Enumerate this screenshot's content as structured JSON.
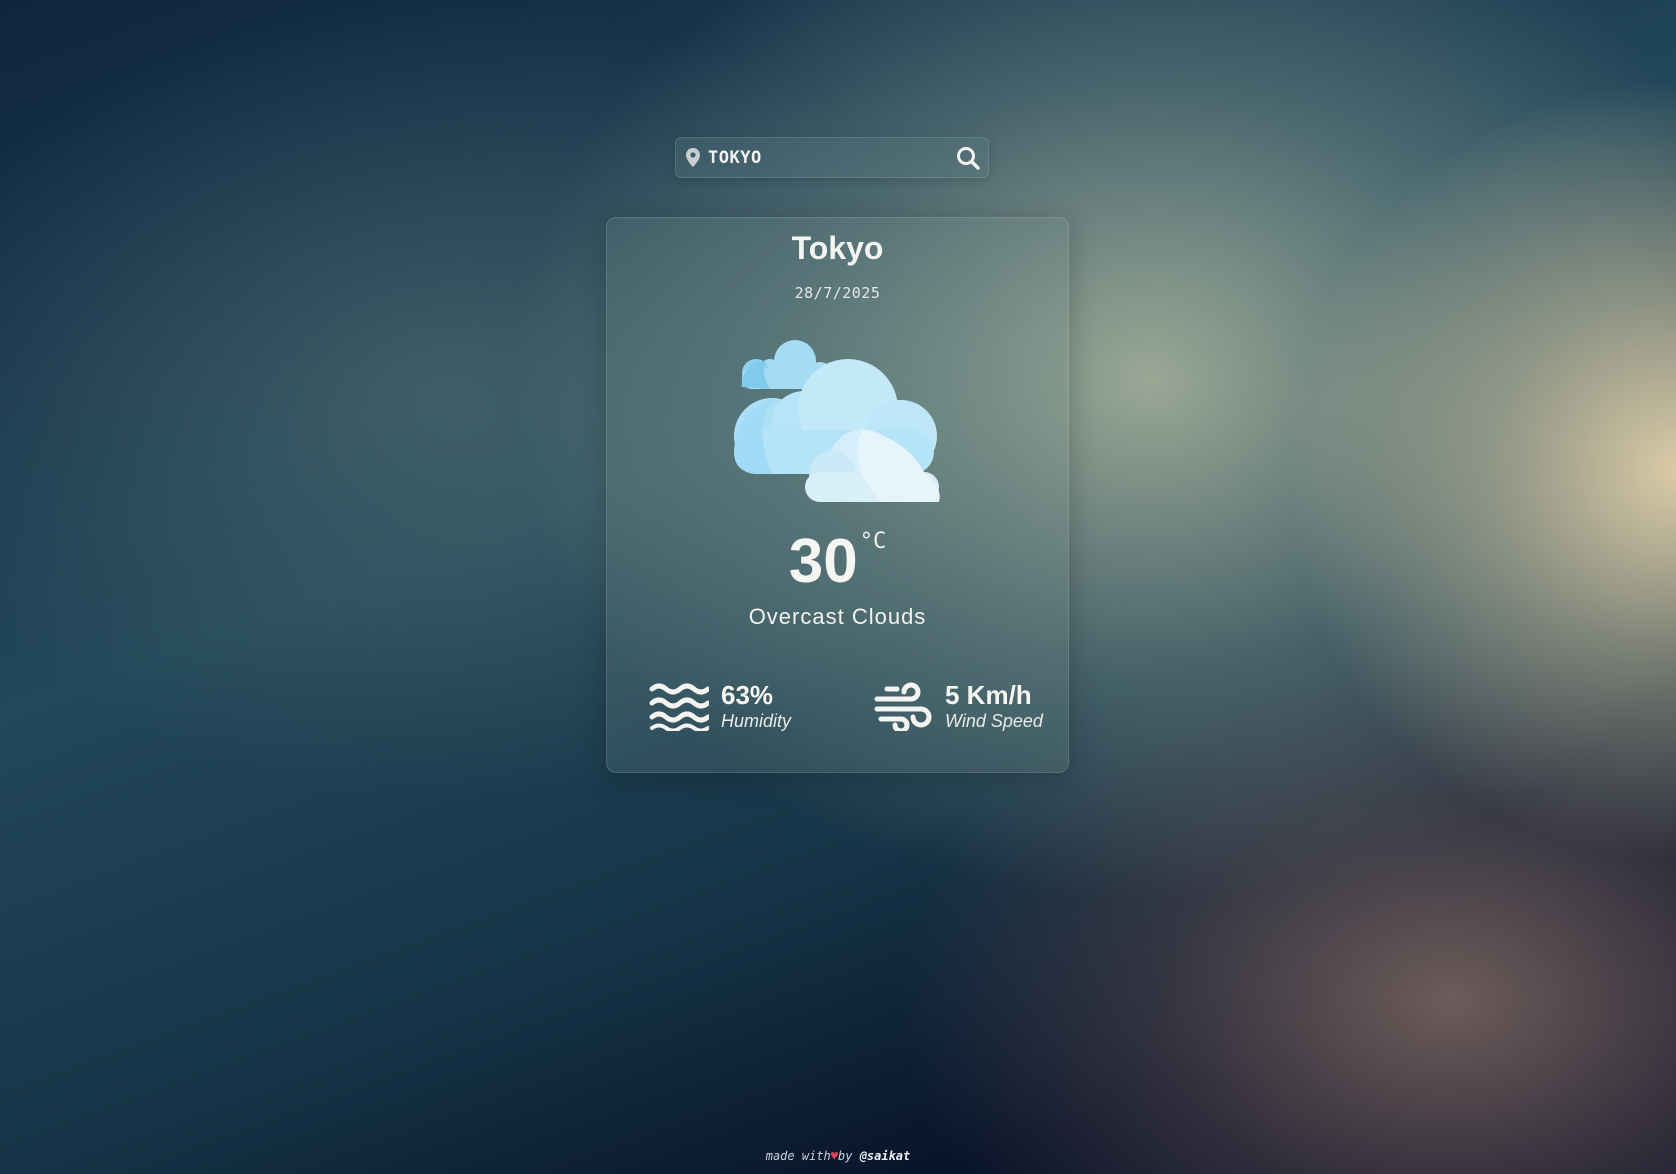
{
  "search": {
    "value": "Tokyo",
    "location_icon": "map-pin-icon",
    "button_icon": "search-icon"
  },
  "weather": {
    "city": "Tokyo",
    "date": "28/7/2025",
    "icon": "overcast-clouds-icon",
    "temperature": "30",
    "unit": "°C",
    "condition": "Overcast Clouds",
    "humidity": {
      "icon": "humidity-waves-icon",
      "value": "63%",
      "label": "Humidity"
    },
    "wind": {
      "icon": "wind-icon",
      "value": "5 Km/h",
      "label": "Wind Speed"
    }
  },
  "footer": {
    "prefix": "made with",
    "heart": "♥",
    "by": "by",
    "handle": "@saikat"
  },
  "colors": {
    "cloud_light": "#e3f3fb",
    "cloud_mid": "#bfe6f8",
    "cloud_dark": "#9fd6f2",
    "heart": "#e0405f"
  }
}
